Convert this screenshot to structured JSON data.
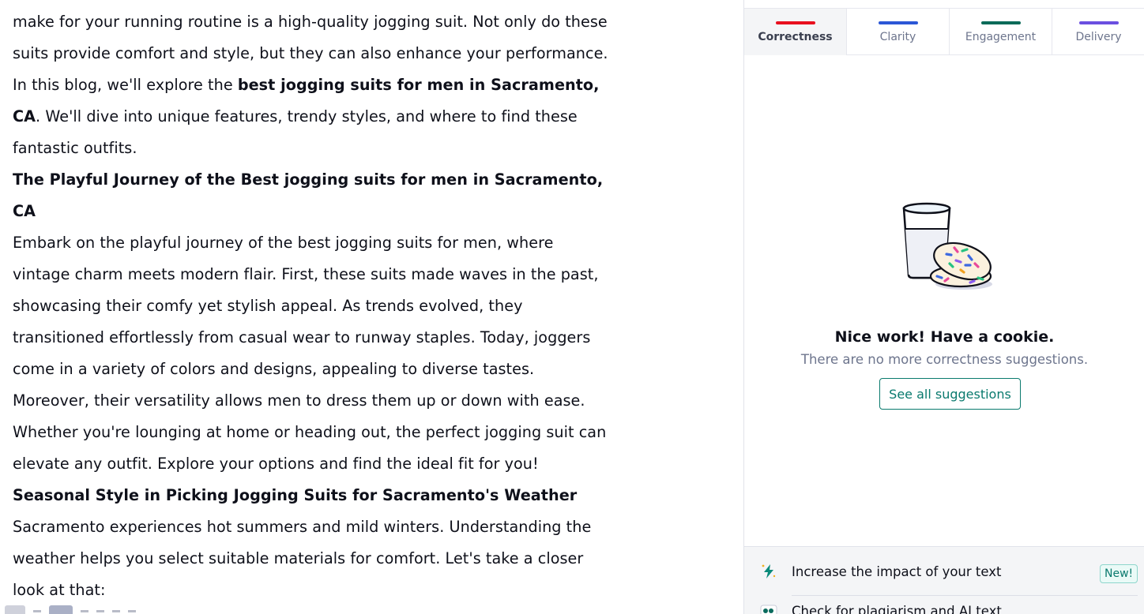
{
  "editor": {
    "paragraphs": [
      [
        {
          "t": "make for your running routine is a high-quality jogging suit. Not only do these suits provide comfort and style, but they can also enhance your performance. In this blog, we'll explore the ",
          "b": false
        },
        {
          "t": "best jogging suits for men in Sacramento, CA",
          "b": true
        },
        {
          "t": ". We'll dive into unique features, trendy styles, and where to find these fantastic outfits.",
          "b": false
        }
      ],
      [
        {
          "t": "The Playful Journey of the Best jogging suits for men in Sacramento, CA",
          "b": true
        }
      ],
      [
        {
          "t": "Embark on the playful journey of the best jogging suits for men, where vintage charm meets modern flair. First, these suits made waves in the past, showcasing their comfy yet stylish appeal. As trends evolved, they transitioned effortlessly from casual wear to runway staples. Today, joggers come in a variety of colors and designs, appealing to diverse tastes. Moreover, their versatility allows men to dress them up or down with ease. Whether you're lounging at home or heading out, the perfect jogging suit can elevate any outfit. Explore your options and find the ideal fit for you!",
          "b": false
        }
      ],
      [
        {
          "t": "Seasonal Style in Picking Jogging Suits for Sacramento's Weather",
          "b": true
        }
      ],
      [
        {
          "t": "Sacramento experiences hot summers and mild winters. Understanding the weather helps you select suitable materials for comfort. Let's take a closer look at that:",
          "b": false
        }
      ]
    ]
  },
  "panel": {
    "tabs": [
      {
        "label": "Correctness",
        "color": "#e8101f",
        "active": true
      },
      {
        "label": "Clarity",
        "color": "#2b57d6",
        "active": false
      },
      {
        "label": "Engagement",
        "color": "#0b6b59",
        "active": false
      },
      {
        "label": "Delivery",
        "color": "#6b4fe0",
        "active": false
      }
    ],
    "empty_state": {
      "title": "Nice work! Have a cookie.",
      "subtitle": "There are no more correctness suggestions.",
      "button": "See all suggestions",
      "illustration": "milk-and-cookies"
    },
    "features": [
      {
        "label": "Increase the impact of your text",
        "icon": "lightning-icon",
        "badge": "New!"
      },
      {
        "label": "Check for plagiarism and AI text",
        "icon": "quote-icon"
      }
    ]
  }
}
